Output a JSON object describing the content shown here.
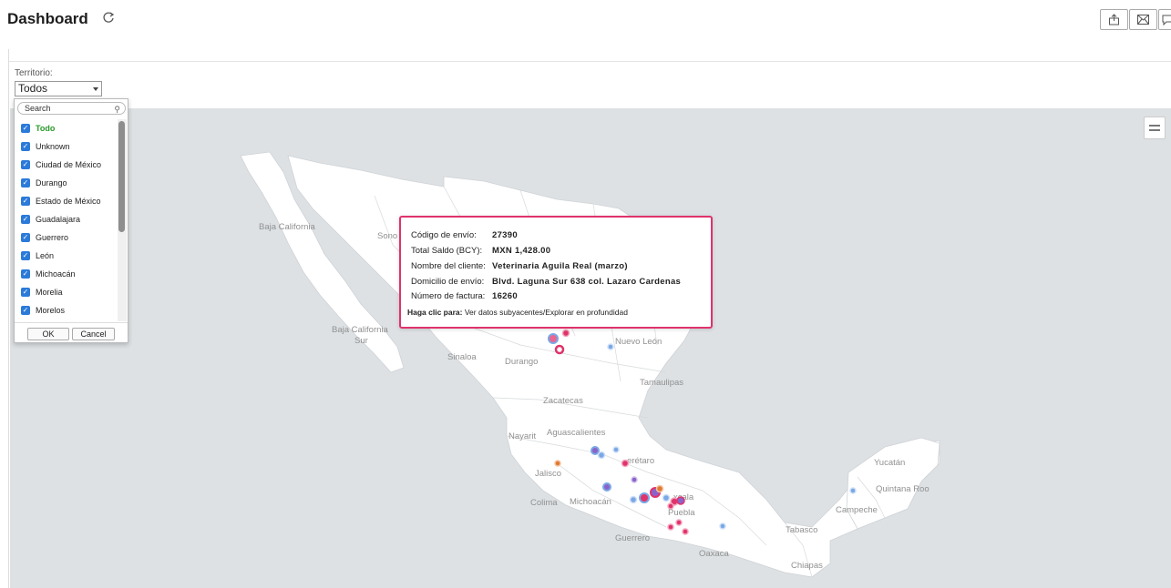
{
  "header": {
    "title": "Dashboard",
    "icons": [
      "refresh-icon",
      "export-icon",
      "email-icon",
      "comment-icon"
    ]
  },
  "filter": {
    "label": "Territorio:",
    "selected": "Todos",
    "search_placeholder": "Search",
    "options": [
      "Todo",
      "Unknown",
      "Ciudad de México",
      "Durango",
      "Estado de México",
      "Guadalajara",
      "Guerrero",
      "León",
      "Michoacán",
      "Morelia",
      "Morelos"
    ],
    "ok_label": "OK",
    "cancel_label": "Cancel",
    "accent_color": "#2b7ad9",
    "all_option_color": "#2a9a2a"
  },
  "map": {
    "labels": {
      "baja_california": "Baja California",
      "sonora": "Sono",
      "bcs_1": "Baja California",
      "bcs_2": "Sur",
      "sinaloa": "Sinaloa",
      "durango": "Durango",
      "nuevo_leon": "Nuevo León",
      "tamaulipas": "Tamaulipas",
      "zacatecas": "Zacatecas",
      "nayarit": "Nayarit",
      "aguascalientes": "Aguascalientes",
      "queretaro": "erétaro",
      "jalisco": "Jalisco",
      "colima": "Colima",
      "michoacan": "Michoacán",
      "tlaxcala": "xcala",
      "puebla": "Puebla",
      "guerrero": "Guerrero",
      "oaxaca": "Oaxaca",
      "tabasco": "Tabasco",
      "chiapas": "Chiapas",
      "campeche": "Campeche",
      "yucatan": "Yucatán",
      "quintana_roo": "Quintana Roo"
    },
    "marker_colors": {
      "pink": "#e0336b",
      "blue": "#7aa7e6",
      "purple": "#8a63c9",
      "orange": "#e07a30"
    }
  },
  "tooltip": {
    "rows": [
      {
        "key": "Código de envío:",
        "value": "27390"
      },
      {
        "key": "Total Saldo (BCY):",
        "value": "MXN 1,428.00"
      },
      {
        "key": "Nombre del cliente:",
        "value": "Veterinaria Aguila Real (marzo)"
      },
      {
        "key": "Domicilio de envío:",
        "value": "Blvd. Laguna Sur 638 col. Lazaro Cardenas"
      },
      {
        "key": "Número de factura:",
        "value": "16260"
      }
    ],
    "footer_key": "Haga clic para:",
    "footer_value": "Ver datos subyacentes/Explorar en profundidad",
    "border_color": "#e0336b"
  }
}
